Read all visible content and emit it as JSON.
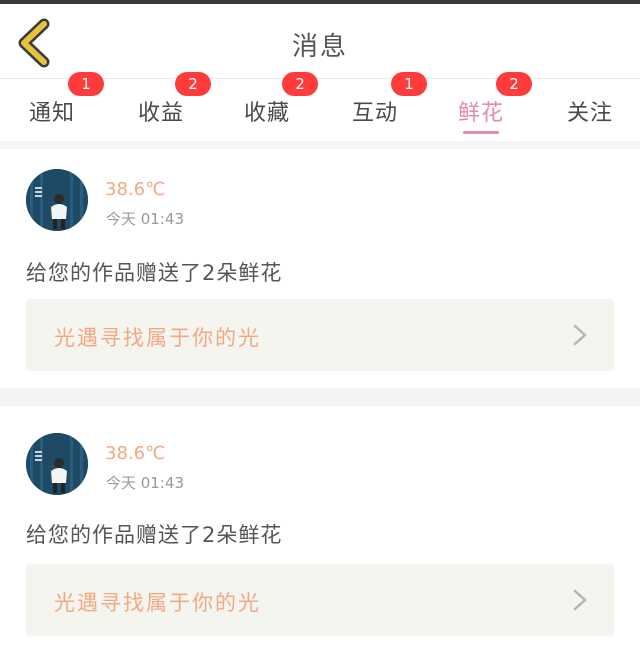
{
  "header": {
    "title": "消息"
  },
  "tabs": [
    {
      "label": "通知",
      "badge": "1"
    },
    {
      "label": "收益",
      "badge": "2"
    },
    {
      "label": "收藏",
      "badge": "2"
    },
    {
      "label": "互动",
      "badge": "1"
    },
    {
      "label": "鲜花",
      "badge": "2",
      "active": true
    },
    {
      "label": "关注",
      "badge": ""
    }
  ],
  "cards": [
    {
      "user": "38.6℃",
      "time": "今天 01:43",
      "message": "给您的作品赠送了2朵鲜花",
      "link": "光遇寻找属于你的光"
    },
    {
      "user": "38.6℃",
      "time": "今天 01:43",
      "message": "给您的作品赠送了2朵鲜花",
      "link": "光遇寻找属于你的光"
    }
  ],
  "colors": {
    "accent_pink": "#e889b0",
    "badge_red": "#ff3b3b",
    "name_peach": "#f2a982",
    "back_arrow": "#e6c33c"
  },
  "icons": {
    "back": "back-arrow-icon",
    "chevron": "chevron-right-icon"
  }
}
